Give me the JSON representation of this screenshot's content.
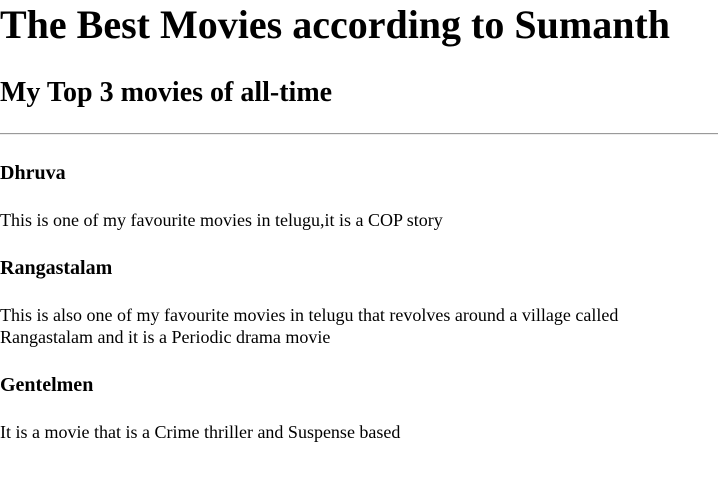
{
  "page": {
    "title": "The Best Movies according to Sumanth",
    "subtitle": "My Top 3 movies of all-time"
  },
  "movies": [
    {
      "title": "Dhruva",
      "description": "This is one of my favourite movies in telugu,it is a COP story"
    },
    {
      "title": "Rangastalam",
      "description": "This is also one of my favourite movies in telugu that revolves around a village called Rangastalam and it is a Periodic drama movie"
    },
    {
      "title": "Gentelmen",
      "description": "It is a movie that is a Crime thriller and Suspense based"
    }
  ]
}
